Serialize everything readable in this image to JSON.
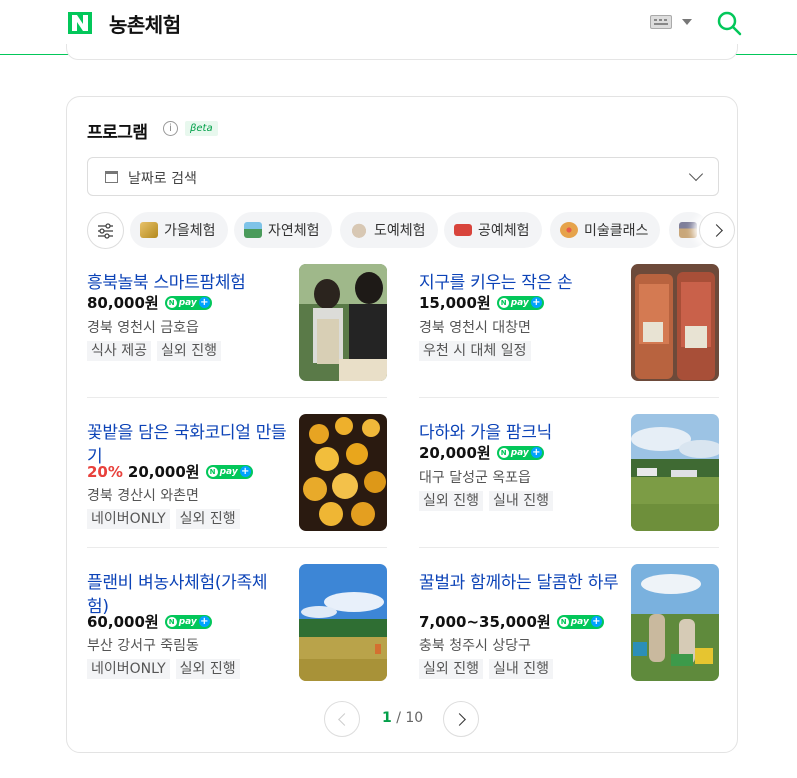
{
  "header": {
    "site_title": "농촌체험"
  },
  "program": {
    "title": "프로그램",
    "beta": "βeta",
    "date_search_label": "날짜로 검색",
    "categories": [
      {
        "label": "가을체험",
        "icon": "wheat-icon",
        "color": "#e2a93a"
      },
      {
        "label": "자연체험",
        "icon": "landscape-icon",
        "color": "#4a9b5b"
      },
      {
        "label": "도예체험",
        "icon": "pottery-icon",
        "color": "#c7b6a2"
      },
      {
        "label": "공예체험",
        "icon": "toolbox-icon",
        "color": "#d8443c"
      },
      {
        "label": "미술클래스",
        "icon": "palette-icon",
        "color": "#e6a34b"
      },
      {
        "label": "",
        "icon": "house-icon",
        "color": "#7f7f9a"
      }
    ],
    "items": [
      {
        "title": "흥북놀북 스마트팜체험",
        "discount": "",
        "price": "80,000원",
        "location": "경북 영천시 금호읍",
        "tags": [
          "식사 제공",
          "실외 진행"
        ],
        "image": "kids-farm-photo"
      },
      {
        "title": "지구를 키우는 작은 손",
        "discount": "",
        "price": "15,000원",
        "location": "경북 영천시 대창면",
        "tags": [
          "우천 시 대체 일정"
        ],
        "image": "jars-photo"
      },
      {
        "title": "꽃밭을 담은 국화코디얼 만들기",
        "discount": "20%",
        "price": "20,000원",
        "location": "경북 경산시 와촌면",
        "tags": [
          "네이버ONLY",
          "실외 진행"
        ],
        "image": "cordial-bottles-photo"
      },
      {
        "title": "다하와 가을 팜크닉",
        "discount": "",
        "price": "20,000원",
        "location": "대구 달성군 옥포읍",
        "tags": [
          "실외 진행",
          "실내 진행"
        ],
        "image": "field-photo"
      },
      {
        "title": "플랜비 벼농사체험(가족체험)",
        "discount": "",
        "price": "60,000원",
        "location": "부산 강서구 죽림동",
        "tags": [
          "네이버ONLY",
          "실외 진행"
        ],
        "image": "rice-field-photo"
      },
      {
        "title": "꿀벌과 함께하는 달콤한 하루",
        "discount": "",
        "price": "7,000~35,000원",
        "location": "충북 청주시 상당구",
        "tags": [
          "실외 진행",
          "실내 진행"
        ],
        "image": "beekeeping-photo"
      }
    ],
    "pagination": {
      "current": "1",
      "separator": " / ",
      "total": "10"
    }
  }
}
